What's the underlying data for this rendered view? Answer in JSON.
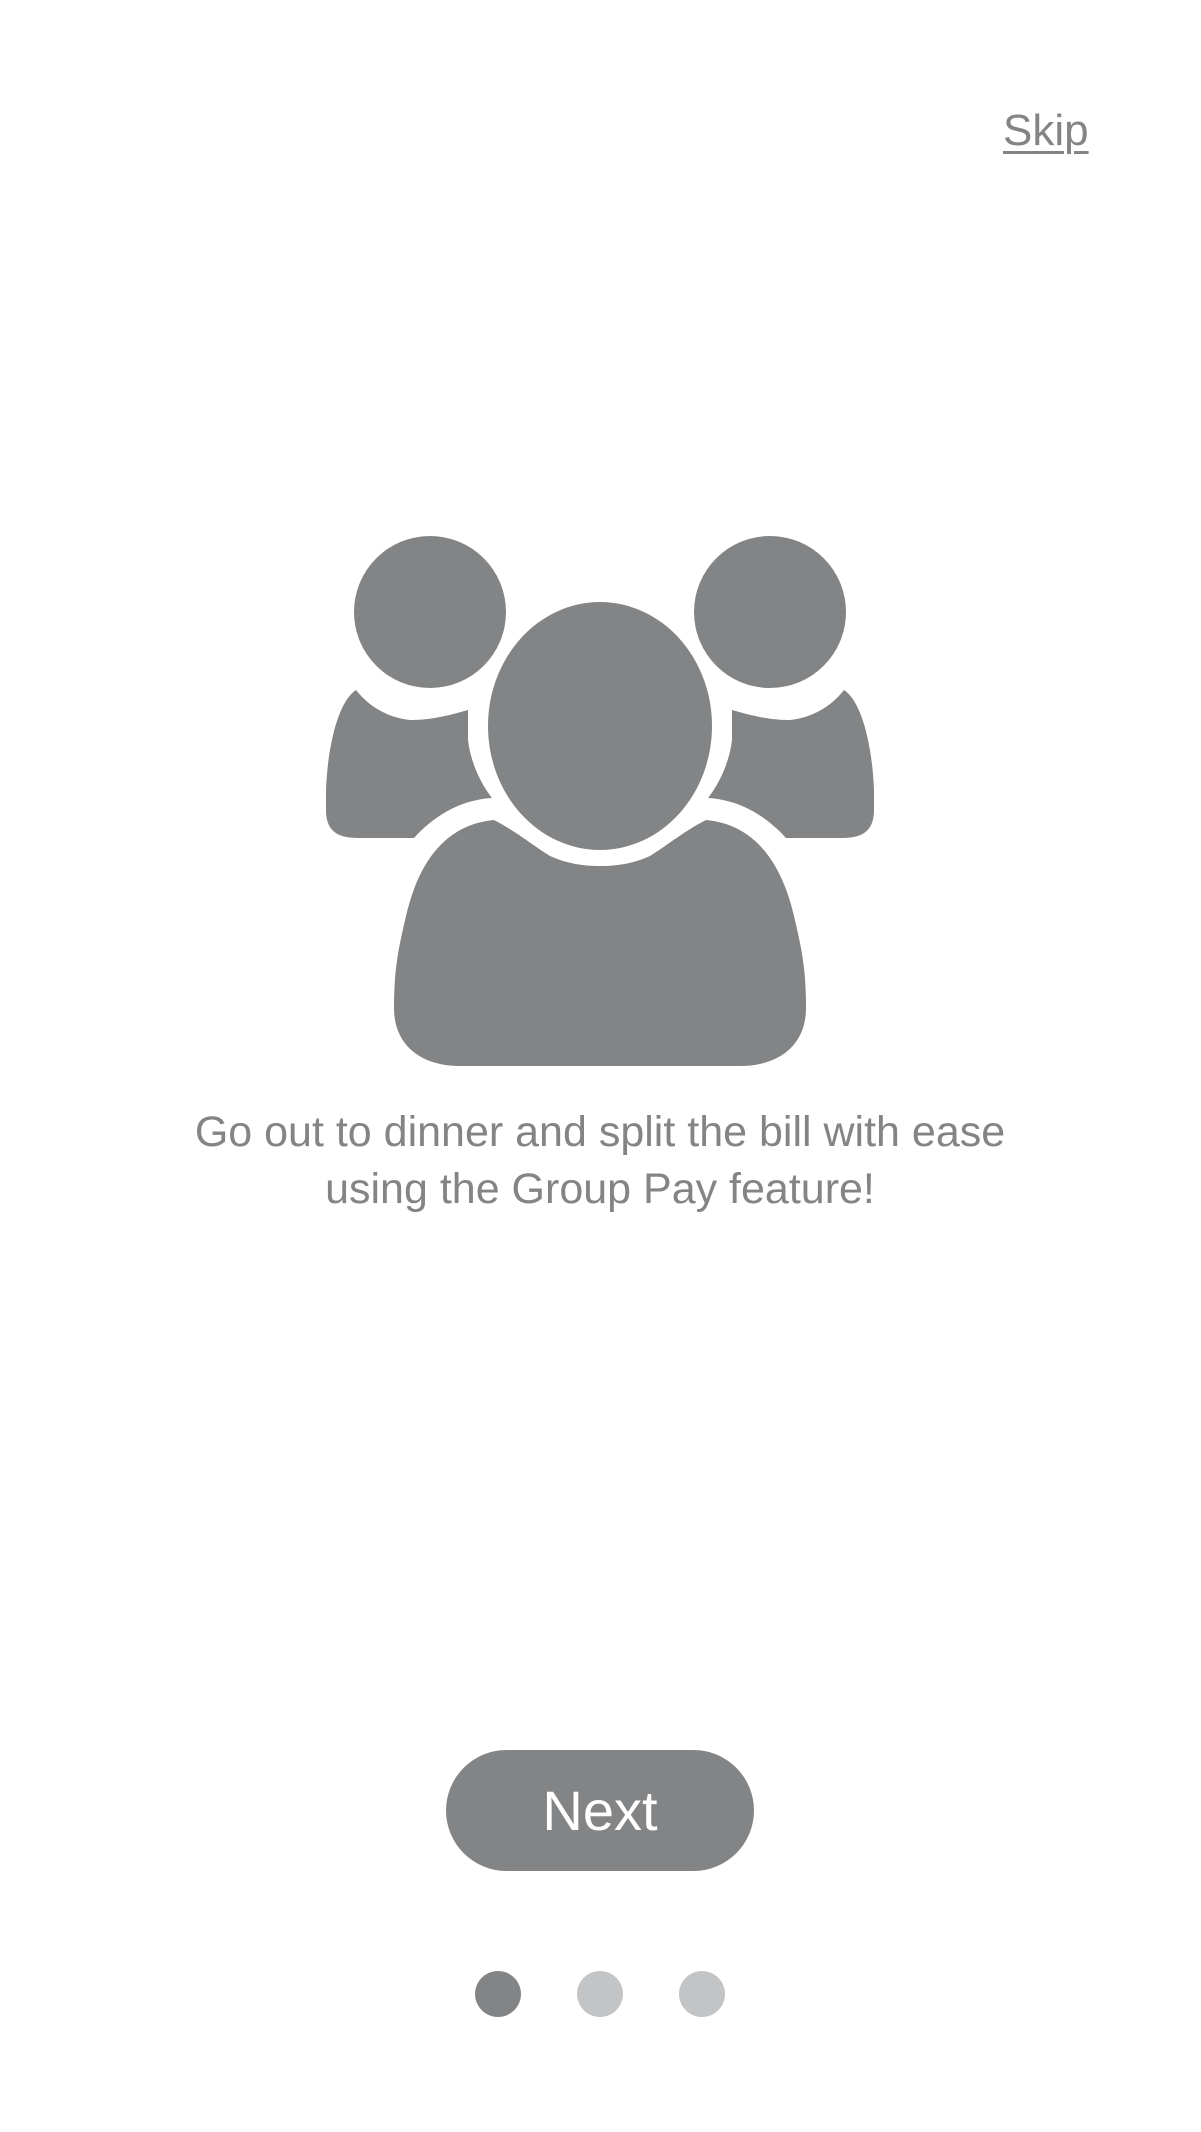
{
  "onboarding": {
    "skip_label": "Skip",
    "caption": "Go out to dinner and split the bill with ease using the Group Pay feature!",
    "next_label": "Next",
    "illustration_icon": "group-people-icon",
    "pager": {
      "total": 3,
      "current": 1
    }
  },
  "colors": {
    "primary_gray": "#838485",
    "inactive_dot": "#c3c4c6",
    "background": "#ffffff",
    "button_text": "#ffffff"
  }
}
